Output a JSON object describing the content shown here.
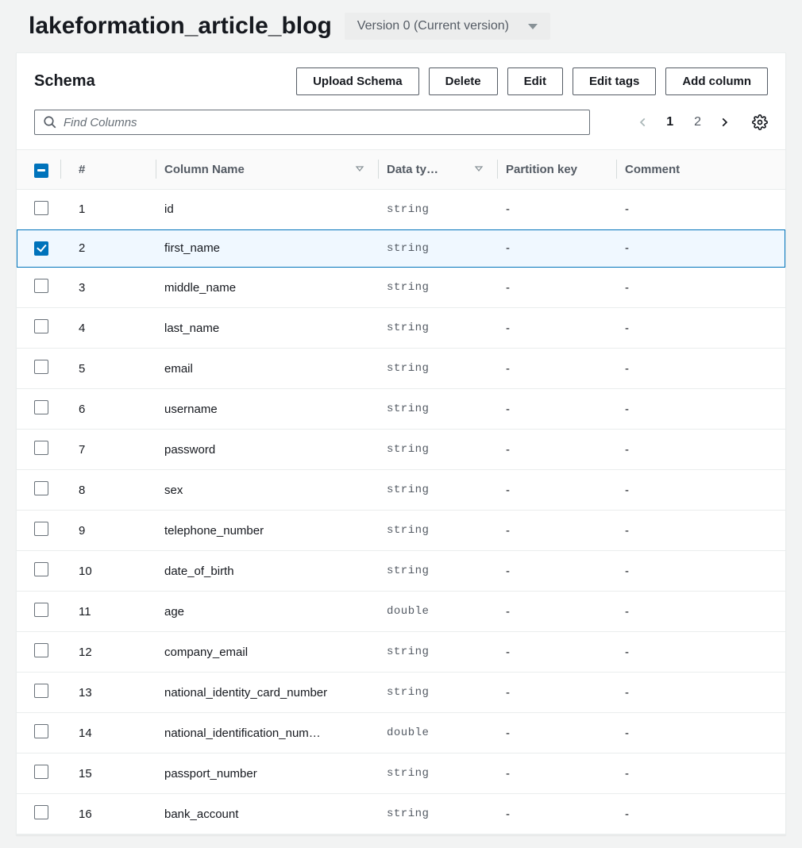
{
  "header": {
    "title": "lakeformation_article_blog",
    "version_label": "Version 0 (Current version)"
  },
  "panel": {
    "title": "Schema",
    "buttons": {
      "upload": "Upload Schema",
      "delete": "Delete",
      "edit": "Edit",
      "edit_tags": "Edit tags",
      "add_column": "Add column"
    },
    "search_placeholder": "Find Columns",
    "pagination": {
      "page1": "1",
      "page2": "2"
    }
  },
  "table": {
    "headers": {
      "num": "#",
      "name": "Column Name",
      "type": "Data ty…",
      "pk": "Partition key",
      "comment": "Comment"
    },
    "rows": [
      {
        "n": "1",
        "name": "id",
        "type": "string",
        "pk": "-",
        "comment": "-",
        "checked": false
      },
      {
        "n": "2",
        "name": "first_name",
        "type": "string",
        "pk": "-",
        "comment": "-",
        "checked": true
      },
      {
        "n": "3",
        "name": "middle_name",
        "type": "string",
        "pk": "-",
        "comment": "-",
        "checked": false
      },
      {
        "n": "4",
        "name": "last_name",
        "type": "string",
        "pk": "-",
        "comment": "-",
        "checked": false
      },
      {
        "n": "5",
        "name": "email",
        "type": "string",
        "pk": "-",
        "comment": "-",
        "checked": false
      },
      {
        "n": "6",
        "name": "username",
        "type": "string",
        "pk": "-",
        "comment": "-",
        "checked": false
      },
      {
        "n": "7",
        "name": "password",
        "type": "string",
        "pk": "-",
        "comment": "-",
        "checked": false
      },
      {
        "n": "8",
        "name": "sex",
        "type": "string",
        "pk": "-",
        "comment": "-",
        "checked": false
      },
      {
        "n": "9",
        "name": "telephone_number",
        "type": "string",
        "pk": "-",
        "comment": "-",
        "checked": false
      },
      {
        "n": "10",
        "name": "date_of_birth",
        "type": "string",
        "pk": "-",
        "comment": "-",
        "checked": false
      },
      {
        "n": "11",
        "name": "age",
        "type": "double",
        "pk": "-",
        "comment": "-",
        "checked": false
      },
      {
        "n": "12",
        "name": "company_email",
        "type": "string",
        "pk": "-",
        "comment": "-",
        "checked": false
      },
      {
        "n": "13",
        "name": "national_identity_card_number",
        "type": "string",
        "pk": "-",
        "comment": "-",
        "checked": false
      },
      {
        "n": "14",
        "name": "national_identification_num…",
        "type": "double",
        "pk": "-",
        "comment": "-",
        "checked": false
      },
      {
        "n": "15",
        "name": "passport_number",
        "type": "string",
        "pk": "-",
        "comment": "-",
        "checked": false
      },
      {
        "n": "16",
        "name": "bank_account",
        "type": "string",
        "pk": "-",
        "comment": "-",
        "checked": false
      }
    ]
  }
}
